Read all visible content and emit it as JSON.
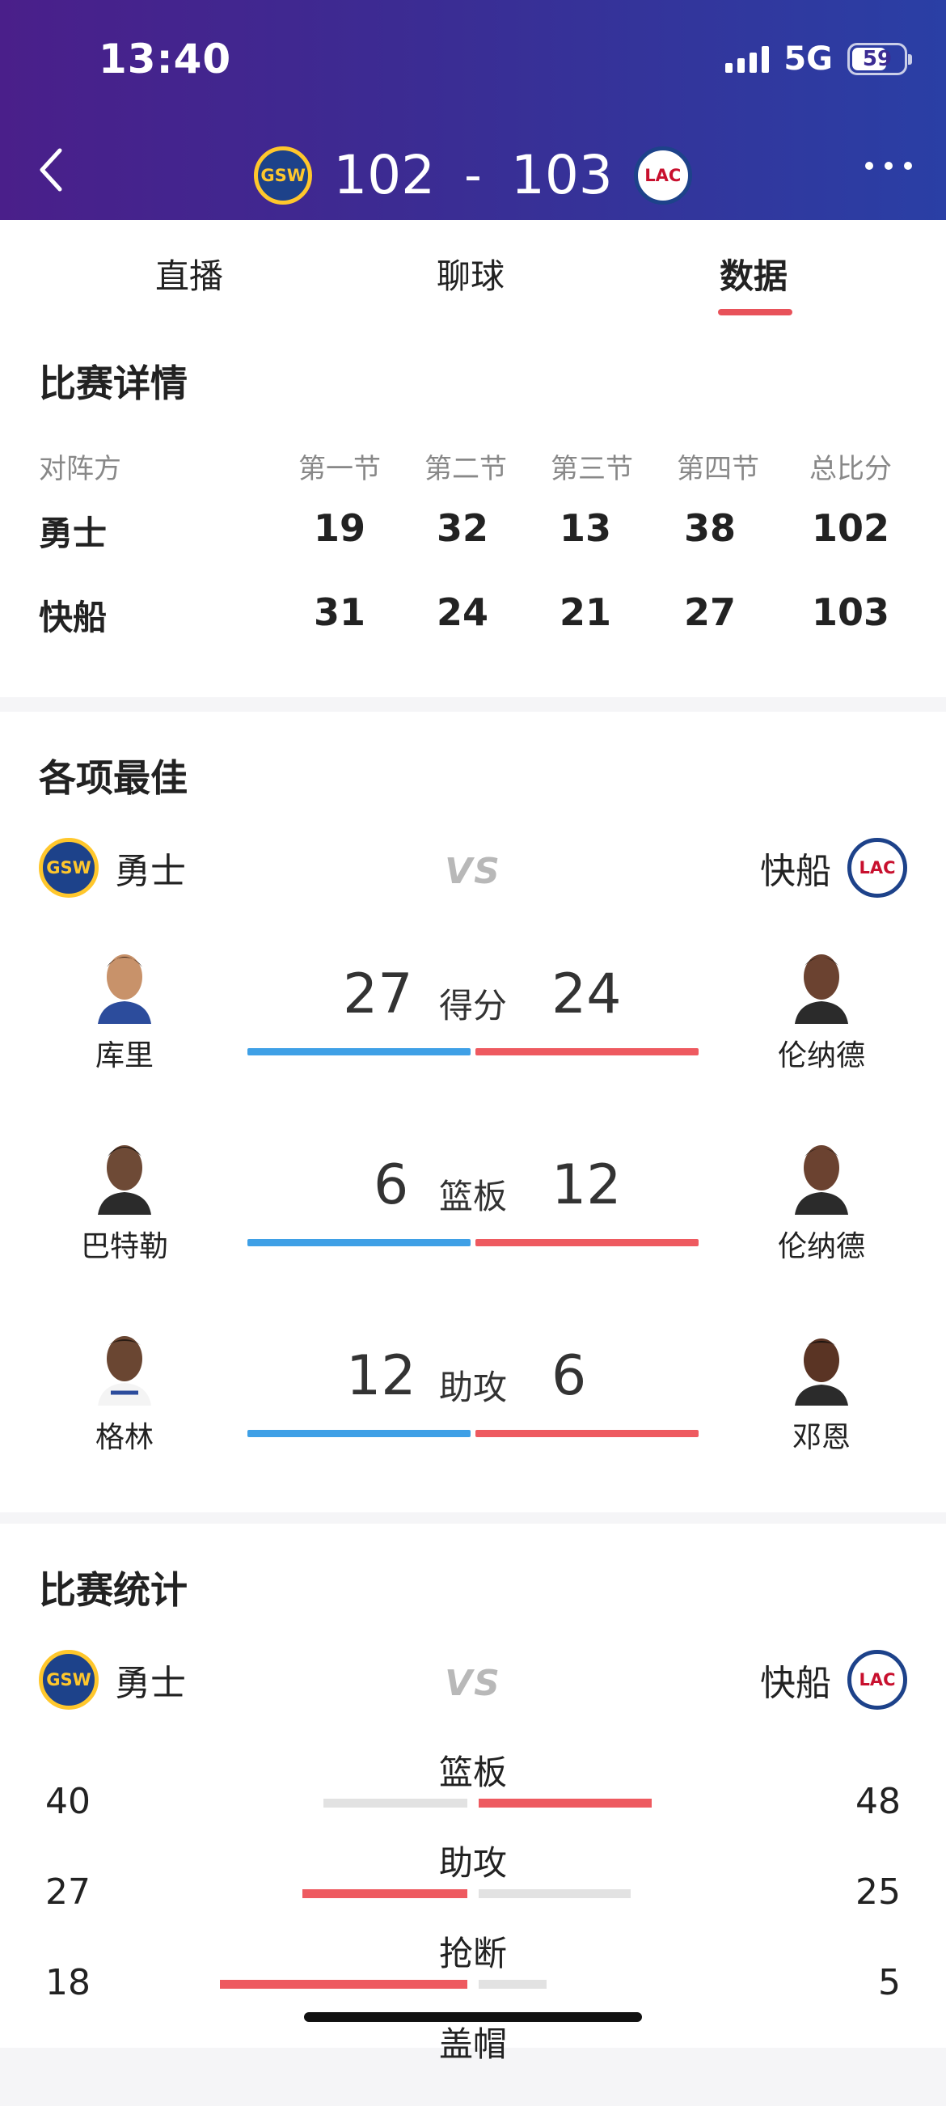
{
  "status": {
    "time": "13:40",
    "network": "5G",
    "battery": "59"
  },
  "header": {
    "home_score": "102",
    "separator": "-",
    "away_score": "103",
    "home_logo": "GSW",
    "away_logo": "LAC"
  },
  "tabs": [
    {
      "label": "直播"
    },
    {
      "label": "聊球"
    },
    {
      "label": "数据",
      "active": true
    }
  ],
  "match_detail": {
    "title": "比赛详情",
    "headers": [
      "对阵方",
      "第一节",
      "第二节",
      "第三节",
      "第四节",
      "总比分"
    ],
    "rows": [
      {
        "team": "勇士",
        "q1": "19",
        "q2": "32",
        "q3": "13",
        "q4": "38",
        "total": "102"
      },
      {
        "team": "快船",
        "q1": "31",
        "q2": "24",
        "q3": "21",
        "q4": "27",
        "total": "103"
      }
    ]
  },
  "leaders": {
    "title": "各项最佳",
    "home_team": "勇士",
    "away_team": "快船",
    "vs": "VS",
    "home_logo": "GSW",
    "away_logo": "LAC",
    "items": [
      {
        "category": "得分",
        "home_player": "库里",
        "home_value": "27",
        "away_player": "伦纳德",
        "away_value": "24"
      },
      {
        "category": "篮板",
        "home_player": "巴特勒",
        "home_value": "6",
        "away_player": "伦纳德",
        "away_value": "12"
      },
      {
        "category": "助攻",
        "home_player": "格林",
        "home_value": "12",
        "away_player": "邓恩",
        "away_value": "6"
      }
    ]
  },
  "team_stats": {
    "title": "比赛统计",
    "home_team": "勇士",
    "away_team": "快船",
    "vs": "VS",
    "home_logo": "GSW",
    "away_logo": "LAC",
    "items": [
      {
        "label": "篮板",
        "home": "40",
        "away": "48"
      },
      {
        "label": "助攻",
        "home": "27",
        "away": "25"
      },
      {
        "label": "抢断",
        "home": "18",
        "away": "5"
      },
      {
        "label": "盖帽",
        "home": "",
        "away": ""
      }
    ]
  },
  "colors": {
    "header_start": "#4a1f8a",
    "header_end": "#2a3fa5",
    "accent_red": "#ee5a60",
    "accent_blue": "#3fa0e6"
  }
}
